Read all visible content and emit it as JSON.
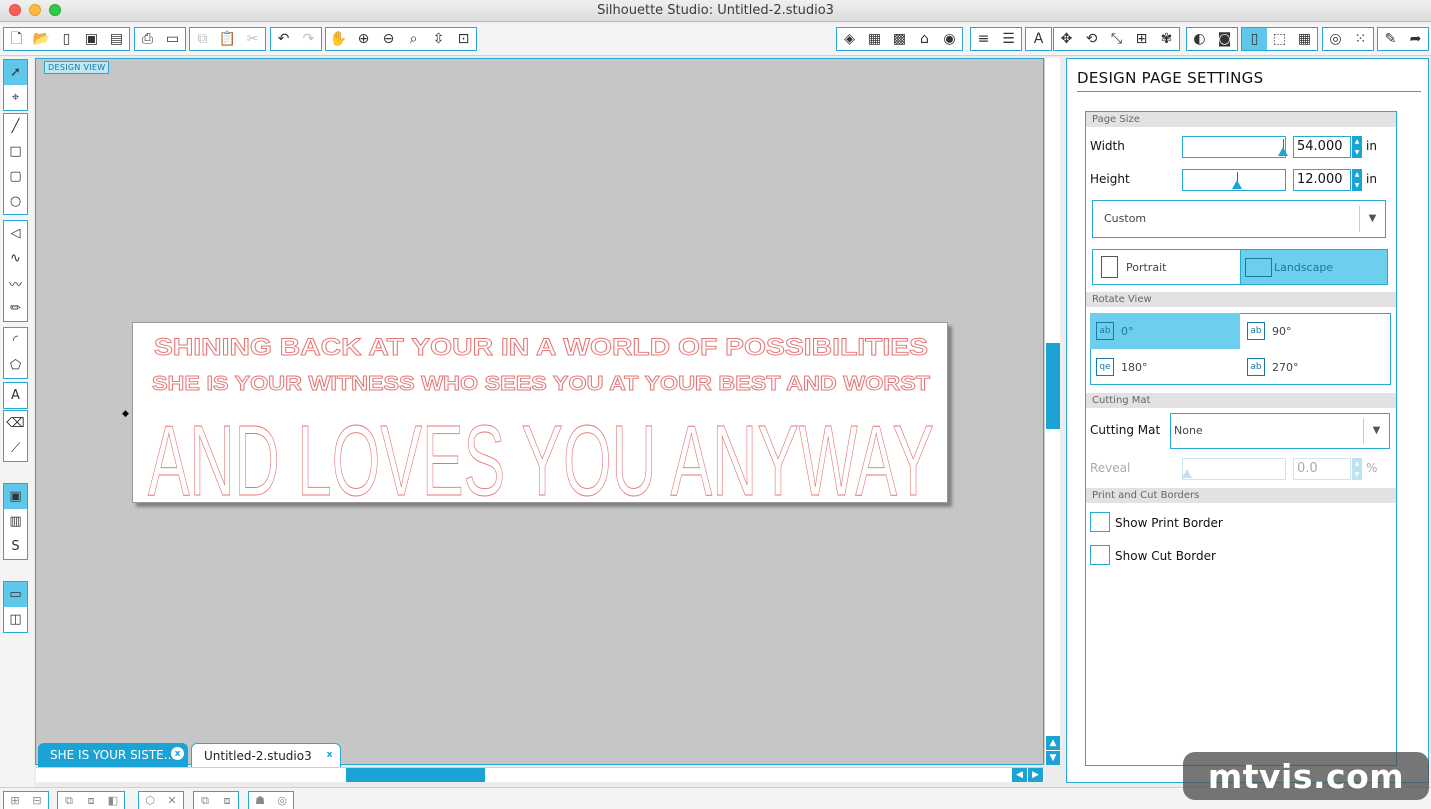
{
  "window": {
    "title": "Silhouette Studio: Untitled-2.studio3"
  },
  "canvas": {
    "view_label": "DESIGN VIEW",
    "lines": [
      {
        "text": "SHINING BACK AT YOUR IN A WORLD OF POSSIBILITIES"
      },
      {
        "text": "SHE IS YOUR WITNESS WHO SEES YOU AT YOUR BEST AND WORST"
      },
      {
        "text": "AND LOVES YOU ANYWAY"
      }
    ],
    "outline_color": "#e57373"
  },
  "tabs": [
    {
      "label": "SHE IS YOUR SISTE...",
      "close": "x"
    },
    {
      "label": "Untitled-2.studio3",
      "close": "x"
    }
  ],
  "panel": {
    "title": "DESIGN PAGE SETTINGS",
    "page_size": {
      "header": "Page Size",
      "width_label": "Width",
      "width_value": "54.000",
      "width_unit": "in",
      "width_slider_fraction": 0.98,
      "height_label": "Height",
      "height_value": "12.000",
      "height_unit": "in",
      "height_slider_fraction": 0.53,
      "preset": "Custom",
      "portrait_label": "Portrait",
      "landscape_label": "Landscape"
    },
    "rotate_view": {
      "header": "Rotate View",
      "options": [
        {
          "label": "0°",
          "icon": "ab"
        },
        {
          "label": "90°",
          "icon": "ab"
        },
        {
          "label": "180°",
          "icon": "qe"
        },
        {
          "label": "270°",
          "icon": "ab"
        }
      ]
    },
    "cutting_mat": {
      "header": "Cutting Mat",
      "label": "Cutting Mat",
      "value": "None",
      "reveal_label": "Reveal",
      "reveal_value": "0.0",
      "reveal_unit": "%"
    },
    "borders": {
      "header": "Print and Cut Borders",
      "show_print_border": "Show Print Border",
      "show_cut_border": "Show Cut Border"
    }
  },
  "watermark": "mtvis.com",
  "colors": {
    "accent": "#1aa3d4",
    "accent_light": "#6dcfee"
  }
}
